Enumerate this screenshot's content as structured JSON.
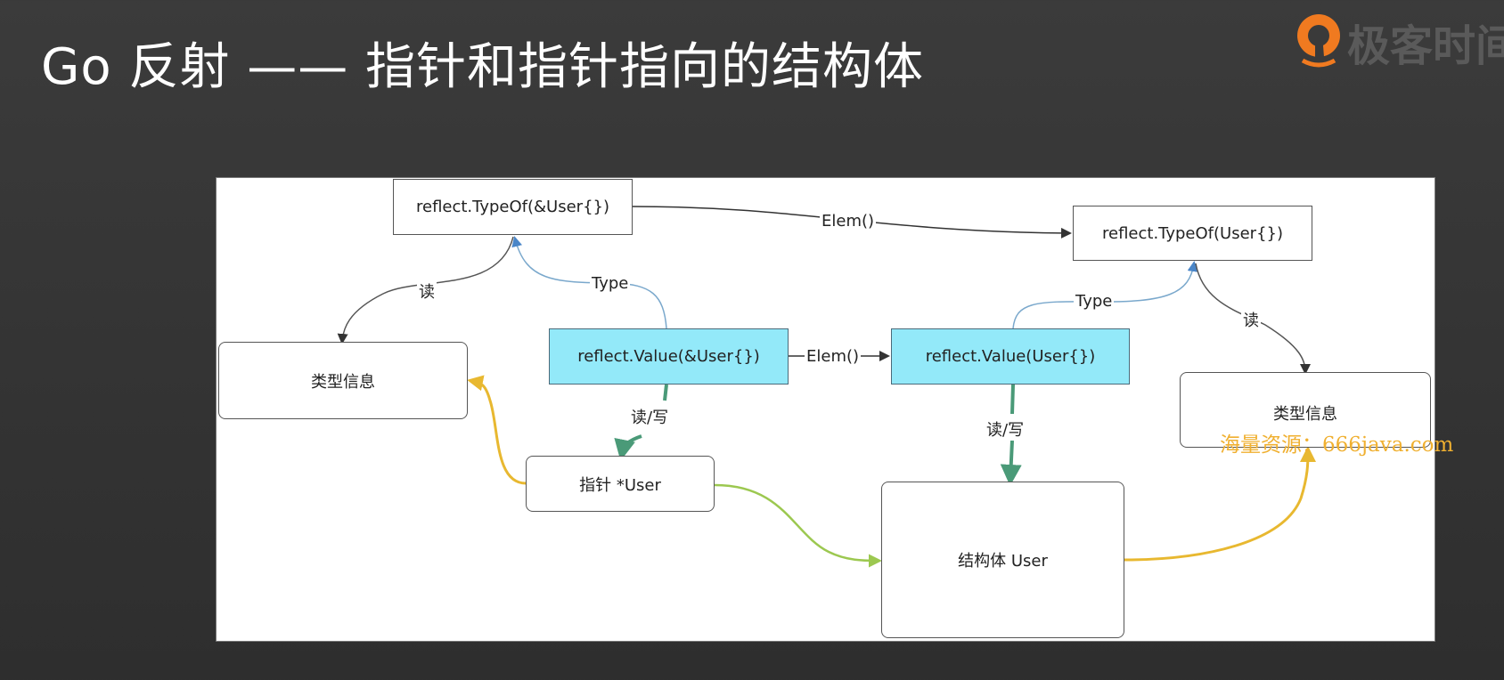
{
  "title": "Go 反射 —— 指针和指针指向的结构体",
  "logo": {
    "text": "极客时间"
  },
  "nodes": {
    "typeof_ptr": "reflect.TypeOf(&User{})",
    "typeof_val": "reflect.TypeOf(User{})",
    "typeinfo_left": "类型信息",
    "typeinfo_right": "类型信息",
    "value_ptr": "reflect.Value(&User{})",
    "value_val": "reflect.Value(User{})",
    "pointer": "指针 *User",
    "struct": "结构体 User"
  },
  "edges": {
    "elem_top": "Elem()",
    "elem_mid": "Elem()",
    "type_left": "Type",
    "type_right": "Type",
    "read_left": "读",
    "read_right": "读",
    "rw_left": "读/写",
    "rw_right": "读/写"
  },
  "colors": {
    "cyan": "#93e9f9",
    "blue_edge": "#6a9ec8",
    "green_edge": "#4a9a78",
    "yellow_edge": "#e8b830",
    "lime_edge": "#9cc850"
  },
  "watermark": "海量资源：666java.com"
}
